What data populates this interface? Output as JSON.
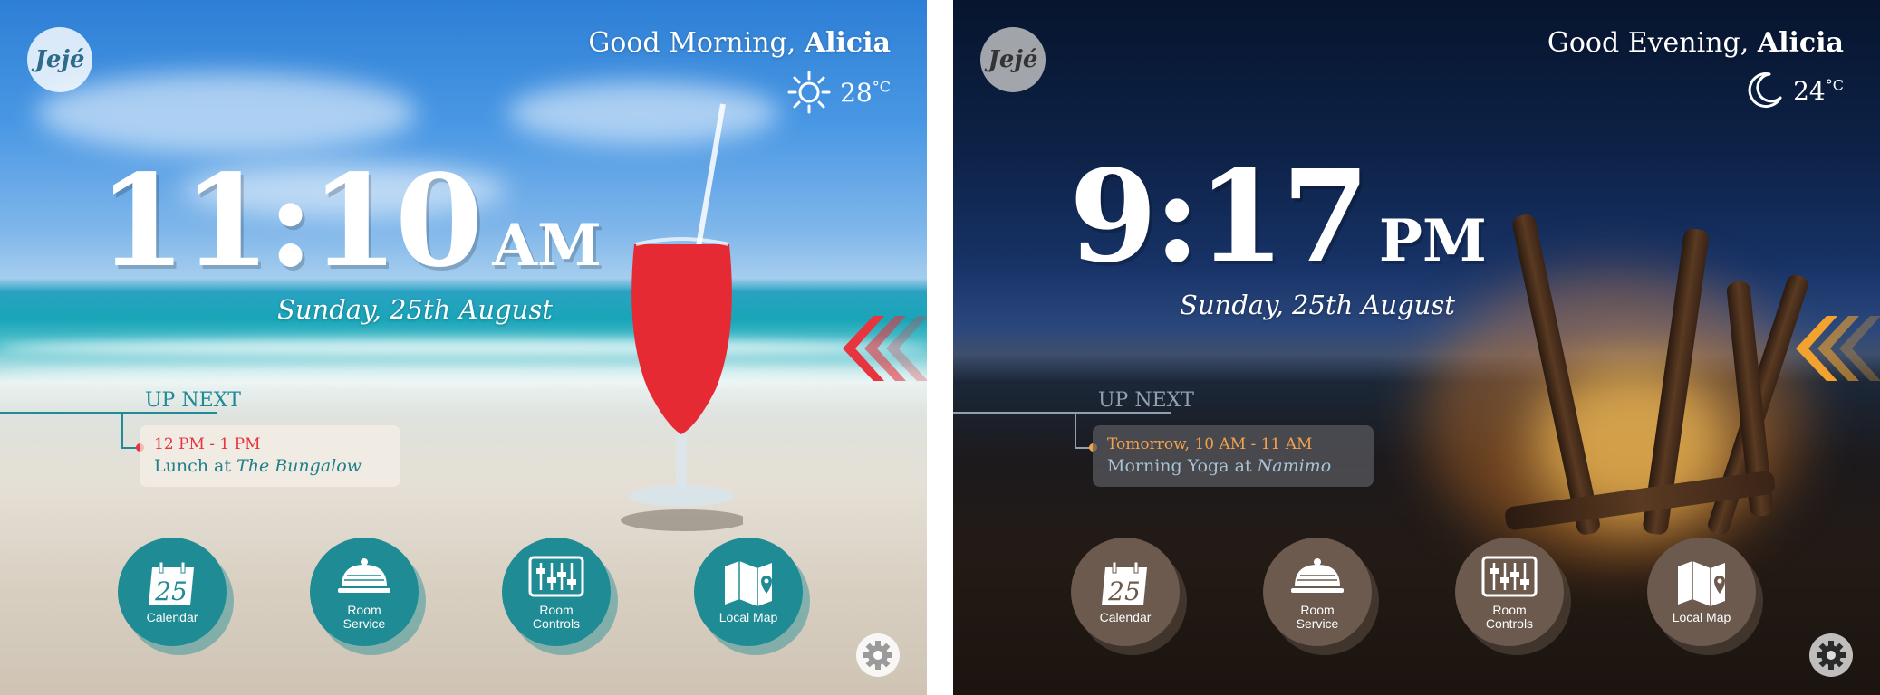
{
  "day": {
    "logo": "Jejé",
    "greeting_prefix": "Good Morning,",
    "user_name": "Alicia",
    "weather_icon": "sun-icon",
    "temperature": "28",
    "temperature_unit": "°C",
    "time": "11:10",
    "ampm": "AM",
    "date": "Sunday, 25th August",
    "upnext_label": "UP NEXT",
    "event_time": "12 PM - 1 PM",
    "event_title_prefix": "Lunch",
    "event_title_at": "at",
    "event_place": "The Bungalow",
    "calendar_day": "25",
    "buttons": {
      "calendar": "Calendar",
      "room_service_1": "Room",
      "room_service_2": "Service",
      "room_controls_1": "Room",
      "room_controls_2": "Controls",
      "local_map": "Local Map"
    },
    "colors": {
      "accent": "#1f8b94",
      "chevron": "#e8343e",
      "event_time": "#e8343e"
    }
  },
  "night": {
    "logo": "Jejé",
    "greeting_prefix": "Good Evening,",
    "user_name": "Alicia",
    "weather_icon": "moon-icon",
    "temperature": "24",
    "temperature_unit": "°C",
    "time": "9:17",
    "ampm": "PM",
    "date": "Sunday, 25th August",
    "upnext_label": "UP NEXT",
    "event_time": "Tomorrow, 10 AM - 11 AM",
    "event_title_prefix": "Morning Yoga",
    "event_title_at": "at",
    "event_place": "Namimo",
    "calendar_day": "25",
    "buttons": {
      "calendar": "Calendar",
      "room_service_1": "Room",
      "room_service_2": "Service",
      "room_controls_1": "Room",
      "room_controls_2": "Controls",
      "local_map": "Local Map"
    },
    "colors": {
      "accent": "#6b5a4d",
      "chevron": "#f2a22f",
      "event_time": "#f2a24a"
    }
  }
}
